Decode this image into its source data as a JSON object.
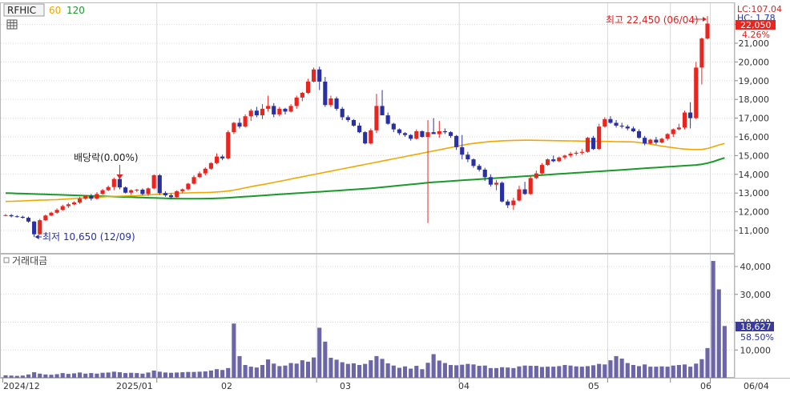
{
  "header": {
    "ticker": "RFHIC",
    "ma_short_label": "60",
    "ma_long_label": "120"
  },
  "price_panel": {
    "lc_label": "LC:107.04",
    "hc_label": "HC: 1.78",
    "current_price": "22,050",
    "change_pct": "4.26%",
    "high_annotation": "최고 22,450 (06/04)",
    "low_annotation": "최저 10,650 (12/09)",
    "dividend_annotation": "배당락(0.00%)",
    "y_ticks": [
      "22,000",
      "21,000",
      "20,000",
      "19,000",
      "18,000",
      "17,000",
      "16,000",
      "15,000",
      "14,000",
      "13,000",
      "12,000",
      "11,000"
    ]
  },
  "volume_panel": {
    "title": "거래대금",
    "current_volume": "18,627",
    "volume_pct": "58.50%",
    "y_ticks": [
      "40,000",
      "30,000",
      "20,000",
      "10,000"
    ]
  },
  "x_axis": {
    "labels": [
      "2024/12",
      "2025/01",
      "02",
      "03",
      "04",
      "05",
      "06",
      "06/04"
    ]
  },
  "colors": {
    "up": "#e8261f",
    "down": "#2830a4",
    "ma60": "#f0a800",
    "ma120": "#1a9a2a",
    "volume": "#6c66a8",
    "current_price_box": "#e8261f",
    "current_volume_box": "#3a3a9a",
    "grid": "#d8d8d8"
  },
  "chart_data": [
    {
      "type": "candlestick",
      "title": "RFHIC",
      "x_range": [
        "2024/12",
        "2025/06/04"
      ],
      "ylim": [
        10500,
        22600
      ],
      "candles_ohlc": [
        [
          11800,
          11880,
          11760,
          11820
        ],
        [
          11820,
          11880,
          11700,
          11760
        ],
        [
          11760,
          11820,
          11690,
          11730
        ],
        [
          11730,
          11790,
          11640,
          11680
        ],
        [
          11680,
          11740,
          11420,
          11480
        ],
        [
          11480,
          11500,
          10650,
          10800
        ],
        [
          10800,
          11620,
          10780,
          11550
        ],
        [
          11550,
          11850,
          11500,
          11800
        ],
        [
          11800,
          12000,
          11760,
          11950
        ],
        [
          11950,
          12180,
          11900,
          12100
        ],
        [
          12100,
          12380,
          12050,
          12300
        ],
        [
          12300,
          12480,
          12200,
          12400
        ],
        [
          12400,
          12560,
          12350,
          12500
        ],
        [
          12500,
          12800,
          12420,
          12700
        ],
        [
          12700,
          12900,
          12650,
          12850
        ],
        [
          12850,
          12950,
          12600,
          12700
        ],
        [
          12700,
          13050,
          12650,
          12950
        ],
        [
          12950,
          13220,
          12900,
          13150
        ],
        [
          13150,
          13400,
          13100,
          13320
        ],
        [
          13320,
          13820,
          13150,
          13750
        ],
        [
          13750,
          13900,
          13200,
          13300
        ],
        [
          13300,
          13350,
          12980,
          13020
        ],
        [
          13020,
          13200,
          12900,
          13150
        ],
        [
          13150,
          13220,
          13050,
          13180
        ],
        [
          13180,
          13250,
          12880,
          12950
        ],
        [
          12950,
          13300,
          12850,
          13250
        ],
        [
          13250,
          14000,
          13200,
          13950
        ],
        [
          13950,
          14020,
          12900,
          13000
        ],
        [
          13000,
          13100,
          12800,
          12880
        ],
        [
          12880,
          12980,
          12700,
          12780
        ],
        [
          12780,
          13150,
          12750,
          13100
        ],
        [
          13100,
          13250,
          13000,
          13200
        ],
        [
          13200,
          13550,
          13150,
          13500
        ],
        [
          13500,
          13950,
          13450,
          13850
        ],
        [
          13850,
          14150,
          13800,
          14050
        ],
        [
          14050,
          14380,
          13950,
          14300
        ],
        [
          14300,
          14650,
          14250,
          14600
        ],
        [
          14600,
          15120,
          14550,
          14950
        ],
        [
          14950,
          15050,
          14750,
          14850
        ],
        [
          14850,
          16350,
          14800,
          16250
        ],
        [
          16250,
          16800,
          16150,
          16750
        ],
        [
          16750,
          17000,
          16450,
          16550
        ],
        [
          16550,
          17200,
          16500,
          17100
        ],
        [
          17100,
          17500,
          16850,
          17400
        ],
        [
          17400,
          17600,
          17050,
          17150
        ],
        [
          17150,
          17750,
          16950,
          17500
        ],
        [
          17500,
          18200,
          17350,
          17650
        ],
        [
          17650,
          17800,
          17050,
          17200
        ],
        [
          17200,
          17600,
          17100,
          17500
        ],
        [
          17500,
          17550,
          17200,
          17350
        ],
        [
          17350,
          17750,
          17300,
          17650
        ],
        [
          17650,
          18200,
          17500,
          18100
        ],
        [
          18100,
          18400,
          17900,
          18350
        ],
        [
          18350,
          19100,
          18300,
          18950
        ],
        [
          18950,
          19700,
          18900,
          19600
        ],
        [
          19600,
          19750,
          18500,
          18950
        ],
        [
          18950,
          19200,
          17600,
          17700
        ],
        [
          17700,
          18200,
          17600,
          18050
        ],
        [
          18050,
          18150,
          17400,
          17500
        ],
        [
          17500,
          17600,
          16900,
          17050
        ],
        [
          17050,
          17150,
          16800,
          16900
        ],
        [
          16900,
          16950,
          16550,
          16600
        ],
        [
          16600,
          16750,
          16200,
          16250
        ],
        [
          16250,
          16300,
          15600,
          15650
        ],
        [
          15650,
          16450,
          15600,
          16350
        ],
        [
          16350,
          18300,
          16200,
          17650
        ],
        [
          17650,
          18500,
          17200,
          17150
        ],
        [
          17150,
          17300,
          16650,
          16700
        ],
        [
          16700,
          16750,
          16250,
          16400
        ],
        [
          16400,
          16450,
          16100,
          16200
        ],
        [
          16200,
          16250,
          16000,
          16100
        ],
        [
          16100,
          16150,
          15800,
          15900
        ],
        [
          15900,
          16400,
          15850,
          16300
        ],
        [
          16300,
          16350,
          15950,
          16000
        ],
        [
          16000,
          16900,
          11400,
          16250
        ],
        [
          16250,
          17000,
          16150,
          16150
        ],
        [
          16150,
          16850,
          15950,
          16300
        ],
        [
          16300,
          16450,
          16150,
          16250
        ],
        [
          16250,
          16300,
          15950,
          16050
        ],
        [
          16050,
          16100,
          15300,
          15450
        ],
        [
          15450,
          16100,
          14800,
          15050
        ],
        [
          15050,
          15200,
          14650,
          14800
        ],
        [
          14800,
          14850,
          14350,
          14450
        ],
        [
          14450,
          14550,
          14150,
          14250
        ],
        [
          14250,
          14350,
          13650,
          13850
        ],
        [
          13850,
          14000,
          13350,
          13450
        ],
        [
          13450,
          13700,
          13150,
          13550
        ],
        [
          13550,
          13620,
          12500,
          12550
        ],
        [
          12550,
          12650,
          12200,
          12350
        ],
        [
          12350,
          12750,
          12100,
          12600
        ],
        [
          12600,
          13400,
          12550,
          13200
        ],
        [
          13200,
          13600,
          12900,
          12950
        ],
        [
          12950,
          13900,
          12900,
          13800
        ],
        [
          13800,
          14200,
          13750,
          14050
        ],
        [
          14050,
          14600,
          14000,
          14500
        ],
        [
          14500,
          14850,
          14450,
          14800
        ],
        [
          14800,
          15000,
          14650,
          14700
        ],
        [
          14700,
          14950,
          14650,
          14900
        ],
        [
          14900,
          15050,
          14800,
          15000
        ],
        [
          15000,
          15200,
          14900,
          15100
        ],
        [
          15100,
          15250,
          15000,
          15150
        ],
        [
          15150,
          15350,
          15050,
          15200
        ],
        [
          15200,
          16000,
          15150,
          15950
        ],
        [
          15950,
          16050,
          15300,
          15350
        ],
        [
          15350,
          16700,
          15300,
          16550
        ],
        [
          16550,
          17050,
          16500,
          16950
        ],
        [
          16950,
          17100,
          16700,
          16750
        ],
        [
          16750,
          16900,
          16500,
          16600
        ],
        [
          16600,
          16750,
          16450,
          16550
        ],
        [
          16550,
          16650,
          16350,
          16450
        ],
        [
          16450,
          16550,
          16250,
          16300
        ],
        [
          16300,
          16400,
          15900,
          15950
        ],
        [
          15950,
          16050,
          15550,
          15650
        ],
        [
          15650,
          15900,
          15600,
          15850
        ],
        [
          15850,
          16000,
          15600,
          15700
        ],
        [
          15700,
          15950,
          15650,
          15900
        ],
        [
          15900,
          16200,
          15800,
          16150
        ],
        [
          16150,
          16450,
          16000,
          16400
        ],
        [
          16400,
          16700,
          16350,
          16500
        ],
        [
          16500,
          17400,
          16400,
          17300
        ],
        [
          17300,
          17850,
          16450,
          17000
        ],
        [
          17000,
          20000,
          16950,
          19700
        ],
        [
          19700,
          21300,
          18800,
          21250
        ],
        [
          21250,
          22450,
          21200,
          22050
        ]
      ],
      "volume": [
        900,
        800,
        700,
        800,
        1200,
        2000,
        1500,
        1200,
        1100,
        1300,
        1700,
        1400,
        1600,
        1900,
        1500,
        1700,
        1500,
        1800,
        1900,
        2200,
        2000,
        1700,
        1800,
        1700,
        1500,
        1900,
        2600,
        2200,
        1900,
        1800,
        1900,
        2000,
        2100,
        2100,
        2200,
        2300,
        2600,
        3100,
        2800,
        3500,
        19500,
        7800,
        4600,
        4000,
        3700,
        4600,
        6600,
        5100,
        4200,
        4400,
        5300,
        5100,
        6300,
        5800,
        7300,
        18000,
        13000,
        7200,
        6500,
        5600,
        5000,
        5200,
        4600,
        5000,
        6300,
        7800,
        6800,
        5200,
        4400,
        3600,
        4100,
        3300,
        4300,
        3100,
        5400,
        8500,
        6200,
        5300,
        4600,
        4500,
        4700,
        5000,
        4800,
        4300,
        4400,
        3500,
        3500,
        3800,
        3700,
        3500,
        4100,
        4400,
        4300,
        4300,
        3900,
        4000,
        4000,
        4200,
        4600,
        4400,
        4100,
        4000,
        4200,
        4500,
        5000,
        4800,
        6300,
        7800,
        6900,
        5300,
        4600,
        4200,
        4800,
        4000,
        4000,
        4100,
        4000,
        4400,
        4600,
        4800,
        4000,
        5100,
        6700,
        10700,
        42000,
        31800,
        18627
      ],
      "ma60": [
        12550,
        12560,
        12570,
        12580,
        12595,
        12610,
        12620,
        12630,
        12640,
        12650,
        12670,
        12690,
        12710,
        12730,
        12750,
        12760,
        12775,
        12790,
        12810,
        12820,
        12830,
        12840,
        12850,
        12860,
        12880,
        12900,
        12920,
        12940,
        12960,
        12980,
        12990,
        13000,
        13010,
        13020,
        13025,
        13030,
        13040,
        13060,
        13080,
        13110,
        13160,
        13220,
        13280,
        13340,
        13400,
        13450,
        13510,
        13570,
        13630,
        13690,
        13750,
        13810,
        13870,
        13930,
        13990,
        14050,
        14110,
        14170,
        14230,
        14290,
        14350,
        14410,
        14470,
        14530,
        14590,
        14650,
        14710,
        14770,
        14830,
        14890,
        14950,
        15010,
        15070,
        15130,
        15190,
        15250,
        15310,
        15370,
        15430,
        15490,
        15550,
        15610,
        15650,
        15690,
        15720,
        15750,
        15770,
        15790,
        15800,
        15810,
        15815,
        15820,
        15820,
        15815,
        15810,
        15805,
        15800,
        15795,
        15790,
        15785,
        15780,
        15775,
        15770,
        15765,
        15760,
        15755,
        15750,
        15745,
        15740,
        15735,
        15730,
        15700,
        15660,
        15610,
        15560,
        15510,
        15460,
        15420,
        15380,
        15350,
        15330,
        15320,
        15330,
        15380,
        15470,
        15570,
        15650
      ],
      "ma120": [
        13000,
        12990,
        12980,
        12970,
        12960,
        12950,
        12940,
        12930,
        12920,
        12910,
        12900,
        12890,
        12880,
        12870,
        12860,
        12850,
        12840,
        12830,
        12820,
        12810,
        12800,
        12790,
        12780,
        12770,
        12760,
        12750,
        12740,
        12730,
        12720,
        12710,
        12705,
        12700,
        12700,
        12700,
        12700,
        12705,
        12710,
        12720,
        12730,
        12750,
        12770,
        12790,
        12810,
        12830,
        12850,
        12870,
        12890,
        12910,
        12930,
        12950,
        12970,
        12990,
        13010,
        13030,
        13050,
        13070,
        13090,
        13110,
        13130,
        13150,
        13170,
        13190,
        13210,
        13230,
        13250,
        13280,
        13310,
        13340,
        13370,
        13400,
        13430,
        13460,
        13490,
        13520,
        13550,
        13580,
        13600,
        13620,
        13640,
        13660,
        13680,
        13700,
        13720,
        13740,
        13760,
        13780,
        13800,
        13820,
        13840,
        13860,
        13880,
        13900,
        13920,
        13940,
        13960,
        13980,
        14000,
        14020,
        14040,
        14060,
        14080,
        14100,
        14120,
        14140,
        14160,
        14180,
        14200,
        14220,
        14240,
        14260,
        14280,
        14300,
        14320,
        14340,
        14360,
        14380,
        14400,
        14420,
        14440,
        14460,
        14480,
        14500,
        14540,
        14600,
        14680,
        14780,
        14880
      ]
    }
  ]
}
